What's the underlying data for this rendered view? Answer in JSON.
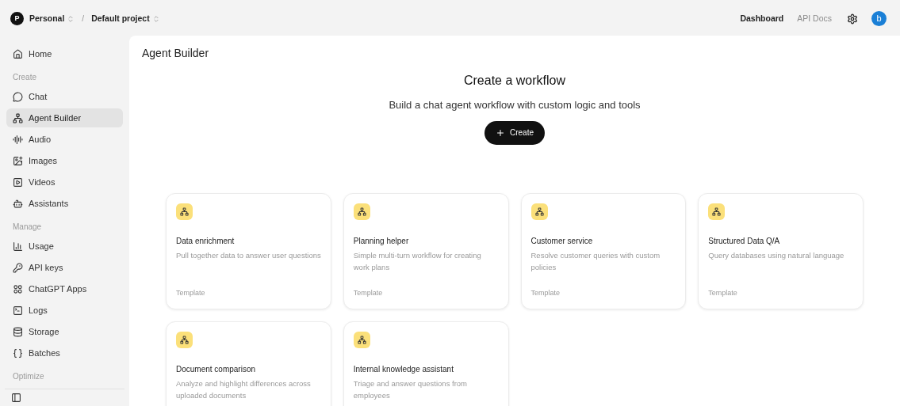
{
  "topbar": {
    "org": {
      "initial": "P",
      "name": "Personal"
    },
    "separator": "/",
    "project": "Default project",
    "links": [
      {
        "label": "Dashboard",
        "selected": true
      },
      {
        "label": "API Docs",
        "selected": false
      }
    ],
    "avatar": "b"
  },
  "sidebar": {
    "items": [
      {
        "kind": "item",
        "label": "Home",
        "selected": false
      },
      {
        "kind": "section",
        "label": "Create"
      },
      {
        "kind": "item",
        "label": "Chat",
        "selected": false
      },
      {
        "kind": "item",
        "label": "Agent Builder",
        "selected": true
      },
      {
        "kind": "item",
        "label": "Audio",
        "selected": false
      },
      {
        "kind": "item",
        "label": "Images",
        "selected": false
      },
      {
        "kind": "item",
        "label": "Videos",
        "selected": false
      },
      {
        "kind": "item",
        "label": "Assistants",
        "selected": false
      },
      {
        "kind": "section",
        "label": "Manage"
      },
      {
        "kind": "item",
        "label": "Usage",
        "selected": false
      },
      {
        "kind": "item",
        "label": "API keys",
        "selected": false
      },
      {
        "kind": "item",
        "label": "ChatGPT Apps",
        "selected": false
      },
      {
        "kind": "item",
        "label": "Logs",
        "selected": false
      },
      {
        "kind": "item",
        "label": "Storage",
        "selected": false
      },
      {
        "kind": "item",
        "label": "Batches",
        "selected": false
      },
      {
        "kind": "section",
        "label": "Optimize"
      }
    ]
  },
  "page": {
    "title": "Agent Builder",
    "heading": "Create a workflow",
    "subheading": "Build a chat agent workflow with custom logic and tools",
    "create_button": "Create",
    "templates": [
      {
        "title": "Data enrichment",
        "description": "Pull together data to answer user questions",
        "tag": "Template"
      },
      {
        "title": "Planning helper",
        "description": "Simple multi-turn workflow for creating work plans",
        "tag": "Template"
      },
      {
        "title": "Customer service",
        "description": "Resolve customer queries with custom policies",
        "tag": "Template"
      },
      {
        "title": "Structured Data Q/A",
        "description": "Query databases using natural language",
        "tag": "Template"
      },
      {
        "title": "Document comparison",
        "description": "Analyze and highlight differences across uploaded documents"
      },
      {
        "title": "Internal knowledge assistant",
        "description": "Triage and answer questions from employees"
      }
    ]
  }
}
